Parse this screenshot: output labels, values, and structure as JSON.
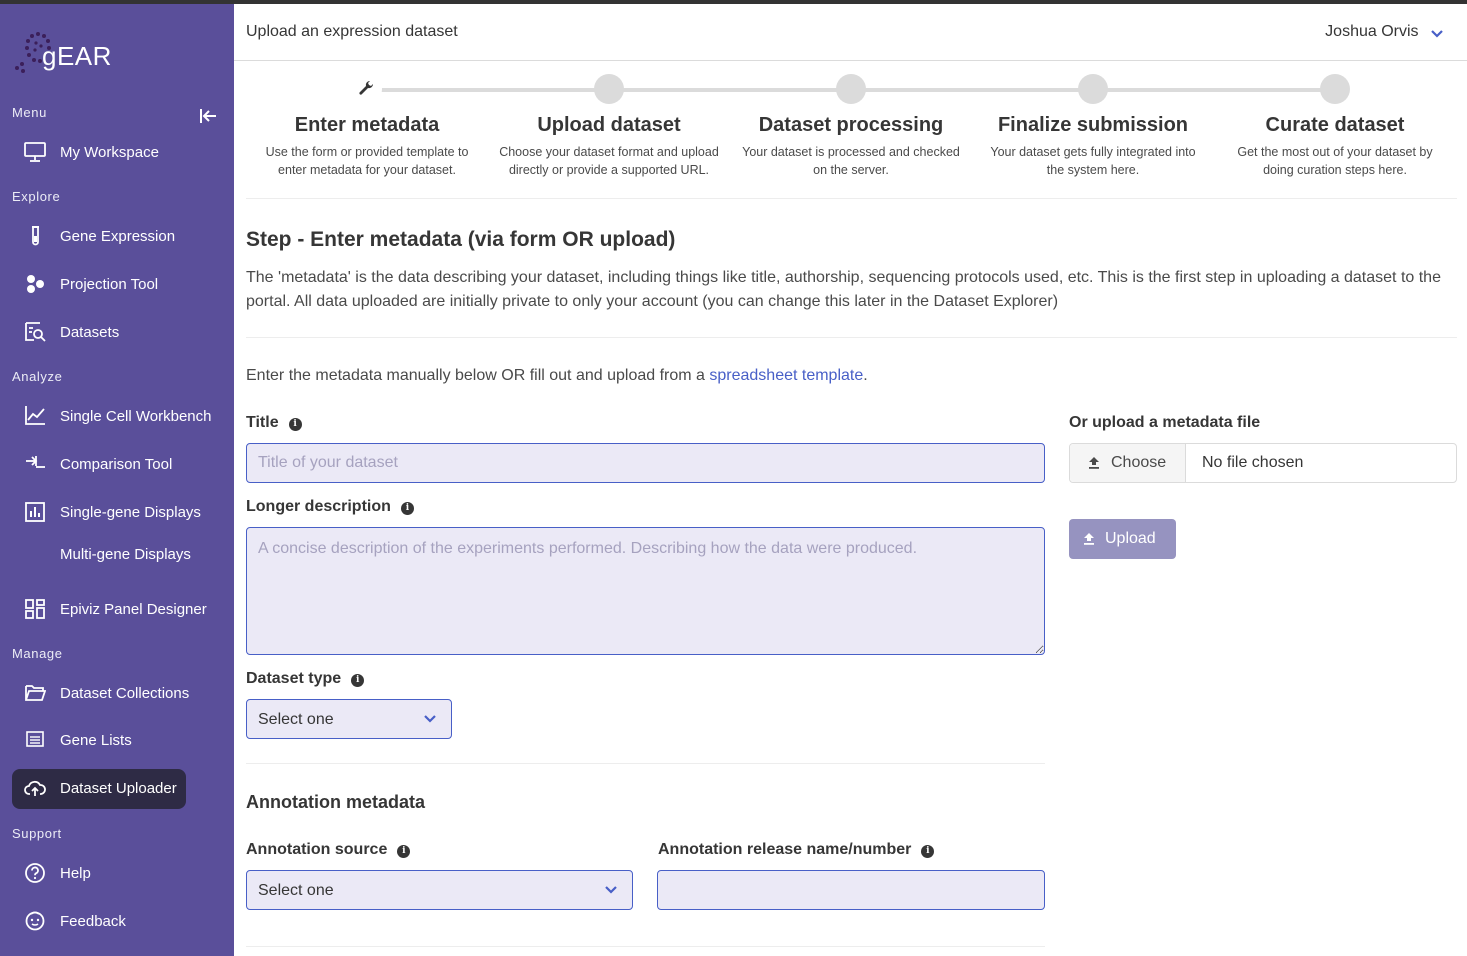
{
  "sidebar": {
    "logo_text": "gEAR",
    "sections": {
      "menu": "Menu",
      "explore": "Explore",
      "analyze": "Analyze",
      "manage": "Manage",
      "support": "Support"
    },
    "items": [
      {
        "label": "My Workspace",
        "icon": "monitor-icon"
      },
      {
        "label": "Gene Expression",
        "icon": "test-tube-icon"
      },
      {
        "label": "Projection Tool",
        "icon": "circles-icon"
      },
      {
        "label": "Datasets",
        "icon": "dataset-search-icon"
      },
      {
        "label": "Single Cell Workbench",
        "icon": "line-chart-icon"
      },
      {
        "label": "Comparison Tool",
        "icon": "compare-arrows-icon"
      },
      {
        "label": "Single-gene Displays",
        "icon": "bar-chart-icon"
      },
      {
        "label": "Multi-gene Displays",
        "icon": "none"
      },
      {
        "label": "Epiviz Panel Designer",
        "icon": "panel-layout-icon"
      },
      {
        "label": "Dataset Collections",
        "icon": "folder-open-icon"
      },
      {
        "label": "Gene Lists",
        "icon": "list-icon"
      },
      {
        "label": "Dataset Uploader",
        "icon": "cloud-upload-icon",
        "active": true
      },
      {
        "label": "Help",
        "icon": "help-circle-icon"
      },
      {
        "label": "Feedback",
        "icon": "feedback-face-icon"
      }
    ]
  },
  "header": {
    "title": "Upload an expression dataset",
    "user_name": "Joshua Orvis"
  },
  "steps": [
    {
      "title": "Enter metadata",
      "desc": "Use the form or provided template to enter metadata for your dataset.",
      "active": true
    },
    {
      "title": "Upload dataset",
      "desc": "Choose your dataset format and upload directly or provide a supported URL."
    },
    {
      "title": "Dataset processing",
      "desc": "Your dataset is processed and checked on the server."
    },
    {
      "title": "Finalize submission",
      "desc": "Your dataset gets fully integrated into the system here."
    },
    {
      "title": "Curate dataset",
      "desc": "Get the most out of your dataset by doing curation steps here."
    }
  ],
  "content": {
    "section_title": "Step - Enter metadata (via form OR upload)",
    "intro": "The 'metadata' is the data describing your dataset, including things like title, authorship, sequencing protocols used, etc. This is the first step in uploading a dataset to the portal. All data uploaded are initially private to only your account (you can change this later in the Dataset Explorer)",
    "manual_prefix": "Enter the metadata manually below OR fill out and upload from a ",
    "manual_link": "spreadsheet template",
    "manual_suffix": ".",
    "title_label": "Title",
    "title_placeholder": "Title of your dataset",
    "description_label": "Longer description",
    "description_placeholder": "A concise description of the experiments performed. Describing how the data were produced.",
    "dataset_type_label": "Dataset type",
    "dataset_type_value": "Select one",
    "upload_file_label": "Or upload a metadata file",
    "choose_label": "Choose",
    "no_file_label": "No file chosen",
    "upload_button": "Upload",
    "annotation_title": "Annotation metadata",
    "annotation_source_label": "Annotation source",
    "annotation_source_value": "Select one",
    "annotation_release_label": "Annotation release name/number",
    "annotation_release_value": ""
  },
  "colors": {
    "sidebar_bg": "#5a4f9a",
    "active_item_bg": "#2e2b45",
    "field_border": "#485fc7",
    "field_bg": "#ebe9f6",
    "link": "#485fc7",
    "upload_button_bg": "#9693c0"
  }
}
